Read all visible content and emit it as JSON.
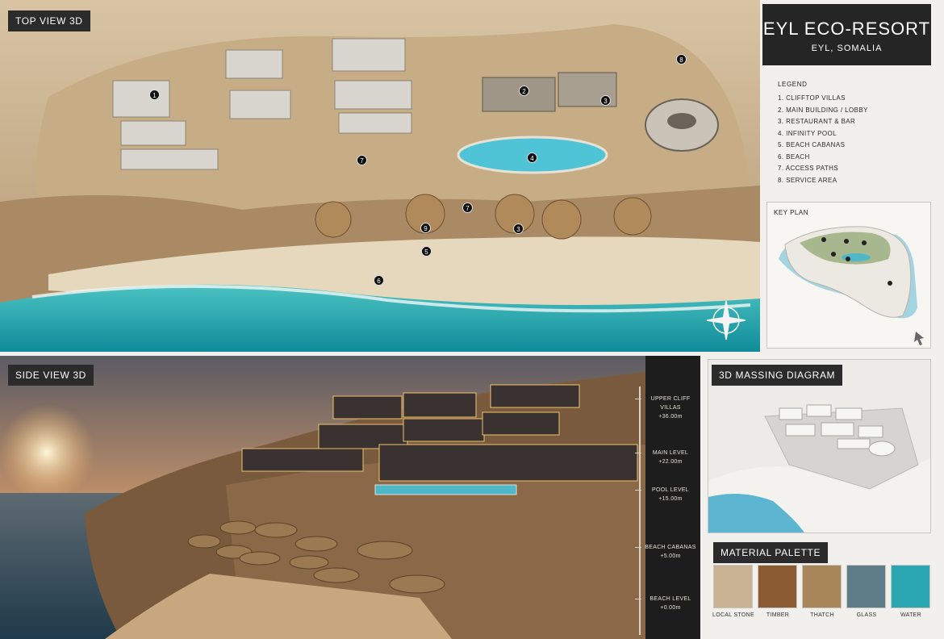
{
  "title": "EYL ECO-RESORT",
  "location": "EYL, SOMALIA",
  "top_view_label": "TOP VIEW 3D",
  "side_view_label": "SIDE VIEW 3D",
  "legend": {
    "heading": "LEGEND",
    "items": [
      "1. CLIFFTOP VILLAS",
      "2. MAIN BUILDING / LOBBY",
      "3. RESTAURANT & BAR",
      "4. INFINITY POOL",
      "5. BEACH CABANAS",
      "6. BEACH",
      "7. ACCESS PATHS",
      "8. SERVICE AREA"
    ]
  },
  "key_plan_label": "KEY PLAN",
  "massing_label": "3D MASSING DIAGRAM",
  "material_palette_label": "MATERIAL PALETTE",
  "materials": [
    {
      "name": "LOCAL STONE",
      "color": "#c9b293"
    },
    {
      "name": "TIMBER",
      "color": "#8a5a33"
    },
    {
      "name": "THATCH",
      "color": "#a8865a"
    },
    {
      "name": "GLASS",
      "color": "#5f7d88"
    },
    {
      "name": "WATER",
      "color": "#2aa7b3"
    }
  ],
  "top_markers": [
    "1",
    "2",
    "3",
    "4",
    "5",
    "6",
    "7",
    "7",
    "8",
    "9",
    "3"
  ],
  "levels": [
    {
      "name": "UPPER CLIFF VILLAS",
      "value": "+36.00m"
    },
    {
      "name": "MAIN LEVEL",
      "value": "+22.00m"
    },
    {
      "name": "POOL LEVEL",
      "value": "+15.00m"
    },
    {
      "name": "BEACH CABANAS",
      "value": "+5.00m"
    },
    {
      "name": "BEACH LEVEL",
      "value": "+0.00m"
    }
  ],
  "colors": {
    "sea": "#1fa3ad",
    "sand": "#d9c5a3",
    "cliff": "#b89a72",
    "dark": "#252525"
  },
  "icons": [
    "compass-rose-icon",
    "cursor-arrow-icon"
  ]
}
